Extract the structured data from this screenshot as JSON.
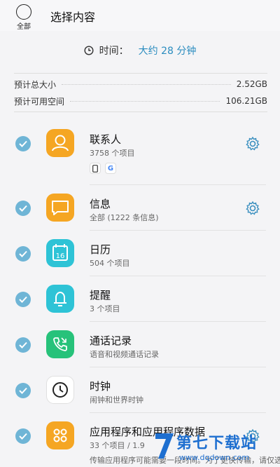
{
  "header": {
    "select_all_label": "全部",
    "title": "选择内容"
  },
  "time": {
    "label": "时间：",
    "value": "大约 28 分钟"
  },
  "sizes": {
    "total_label": "预计总大小",
    "total_value": "2.52GB",
    "free_label": "预计可用空间",
    "free_value": "106.21GB"
  },
  "items": [
    {
      "title": "联系人",
      "subtitle": "3758 个项目",
      "icon": "contacts-icon",
      "color": "#f5a623",
      "settings": true,
      "sources": [
        "phone-icon",
        "google-icon"
      ]
    },
    {
      "title": "信息",
      "subtitle": "全部 (1222 条信息)",
      "icon": "message-icon",
      "color": "#f5a623",
      "settings": true
    },
    {
      "title": "日历",
      "subtitle": "504 个项目",
      "icon": "calendar-icon",
      "color": "#2ec3d6",
      "day": "16"
    },
    {
      "title": "提醒",
      "subtitle": "3 个项目",
      "icon": "bell-icon",
      "color": "#2ec3d6"
    },
    {
      "title": "通话记录",
      "subtitle": "语音和视频通话记录",
      "icon": "phone-call-icon",
      "color": "#27c27a"
    },
    {
      "title": "时钟",
      "subtitle": "闹钟和世界时钟",
      "icon": "clock-icon",
      "color": "#ffffff"
    },
    {
      "title": "应用程序和应用程序数据",
      "subtitle": "33 个项目 / 1.9",
      "subtitle2": "传输应用程序可能需要一段时间。为了更快传输，请仅选",
      "icon": "apps-icon",
      "color": "#f5a623",
      "settings": true
    }
  ],
  "watermark": {
    "text": "第七下载站",
    "url": "www.dqdown.com"
  },
  "colors": {
    "accent": "#2a8cbf",
    "check": "#6fb5d6"
  }
}
